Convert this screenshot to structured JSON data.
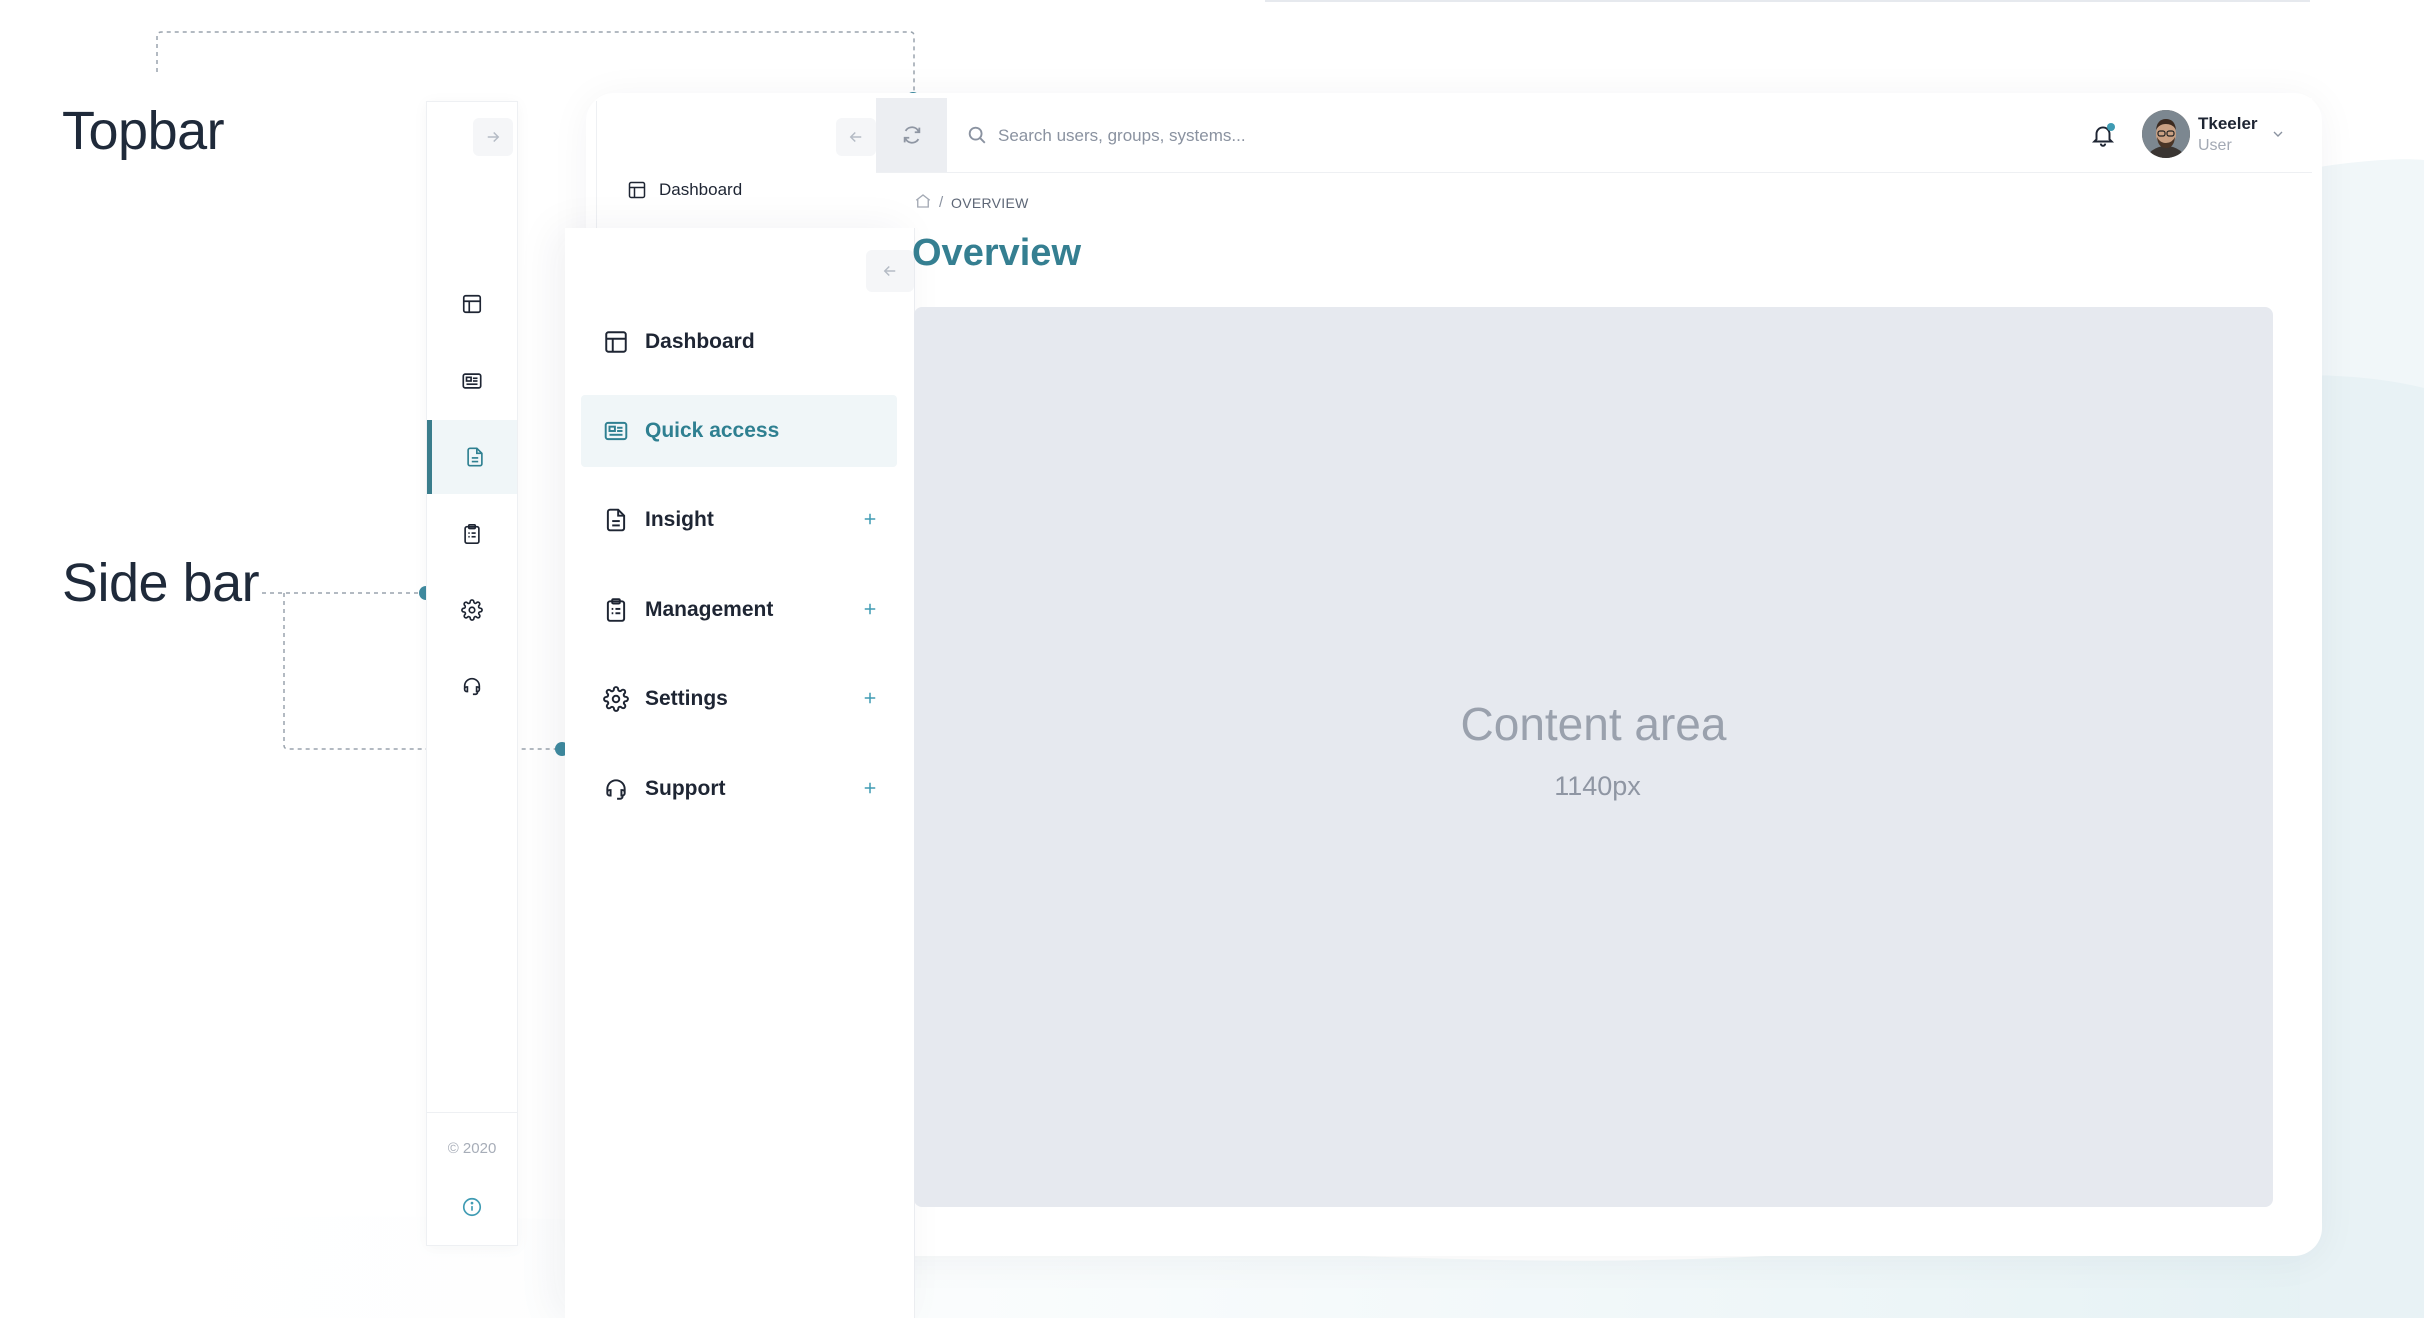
{
  "callouts": {
    "topbar": "Topbar",
    "sidebar": "Side bar"
  },
  "mini_sidebar": {
    "items": [
      {
        "icon": "table-icon"
      },
      {
        "icon": "id-card-icon"
      },
      {
        "icon": "document-icon",
        "active": true
      },
      {
        "icon": "clipboard-icon"
      },
      {
        "icon": "gear-icon"
      },
      {
        "icon": "headset-icon"
      }
    ],
    "copyright": "© 2020"
  },
  "back_sidebar": {
    "dashboard_label": "Dashboard"
  },
  "topbar": {
    "search_placeholder": "Search users, groups, systems...",
    "user_name": "Tkeeler",
    "user_role": "User"
  },
  "sidebar": {
    "items": [
      {
        "label": "Dashboard",
        "icon": "table-icon",
        "expandable": false
      },
      {
        "label": "Quick access",
        "icon": "id-card-icon",
        "expandable": false,
        "active": true
      },
      {
        "label": "Insight",
        "icon": "document-icon",
        "expandable": true
      },
      {
        "label": "Management",
        "icon": "clipboard-icon",
        "expandable": true
      },
      {
        "label": "Settings",
        "icon": "gear-icon",
        "expandable": true
      },
      {
        "label": "Support",
        "icon": "headset-icon",
        "expandable": true
      }
    ]
  },
  "breadcrumb": {
    "separator": "/",
    "current": "OVERVIEW"
  },
  "page": {
    "title": "Overview"
  },
  "content": {
    "title": "Content area",
    "subtitle": "1140px"
  },
  "colors": {
    "accent": "#357f91",
    "active_bg": "#f0f6f8",
    "content_bg": "#e6e9ef",
    "callout_dot": "#3f8ba0"
  }
}
